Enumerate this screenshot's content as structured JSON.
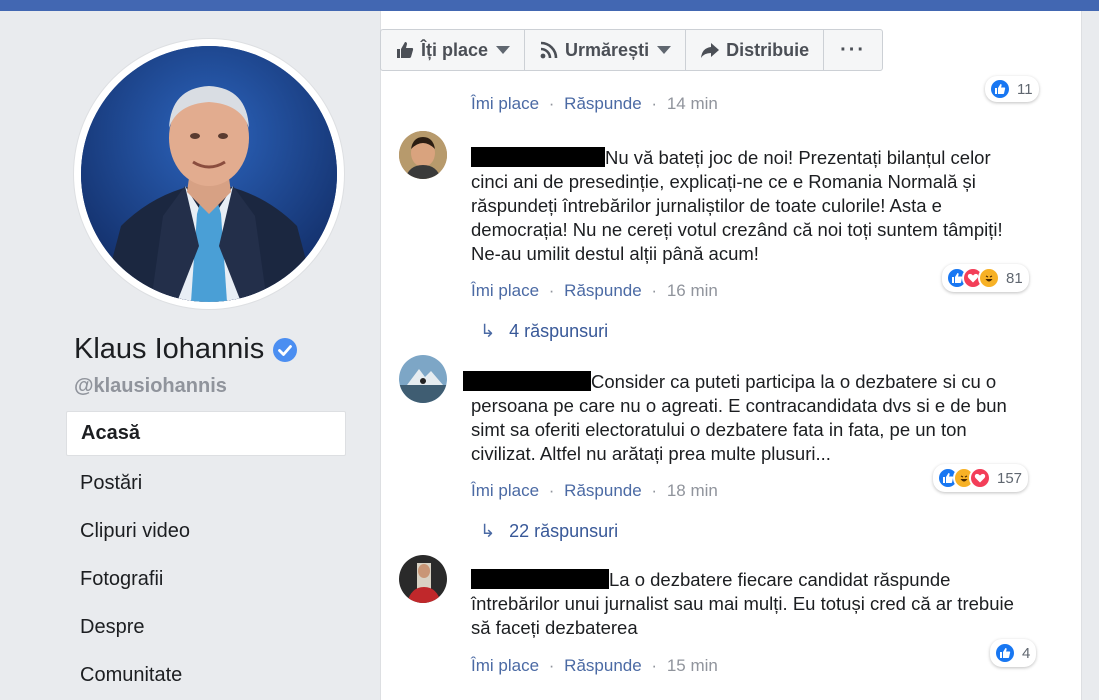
{
  "profile": {
    "name": "Klaus Iohannis",
    "handle": "@klausiohannis"
  },
  "nav": [
    {
      "label": "Acasă",
      "active": true
    },
    {
      "label": "Postări"
    },
    {
      "label": "Clipuri video"
    },
    {
      "label": "Fotografii"
    },
    {
      "label": "Despre"
    },
    {
      "label": "Comunitate"
    }
  ],
  "actions": {
    "like": "Îți place",
    "follow": "Urmărești",
    "share": "Distribuie",
    "more": "···"
  },
  "comment_meta": {
    "like": "Îmi place",
    "reply": "Răspunde",
    "dot": "·"
  },
  "top_partial": {
    "time": "14 min",
    "reactions": "11"
  },
  "comments": [
    {
      "text": "Nu vă bateți joc de noi! Prezentați bilanțul celor cinci ani de presedinție, explicați-ne ce e Romania Normală și răspundeți întrebărilor jurnaliștilor de toate culorile! Asta e democrația! Nu ne cereți votul crezând că noi toți suntem tâmpiți! Ne-au umilit destul alții până acum!",
      "time": "16 min",
      "reaction_count": "81",
      "reactions": [
        "like",
        "love",
        "haha"
      ],
      "replies": "4 răspunsuri"
    },
    {
      "text": "Consider ca puteti participa la o dezbatere si cu o persoana pe care nu o agreati. E contracandidata dvs si e de bun simt sa oferiti electoratului o dezbatere fata in fata, pe un ton civilizat. Altfel nu arătați prea multe plusuri...",
      "time": "18 min",
      "reaction_count": "157",
      "reactions": [
        "like",
        "haha",
        "love"
      ],
      "replies": "22 răspunsuri"
    },
    {
      "text": "La o dezbatere fiecare candidat răspunde întrebărilor unui jurnalist sau mai mulți. Eu totuși cred că ar trebuie să faceți dezbaterea",
      "time": "15 min",
      "reaction_count": "4",
      "reactions": [
        "like"
      ]
    }
  ],
  "colors": {
    "brand": "#4267b2",
    "link": "#385898",
    "like": "#1877f2",
    "love": "#f33e58",
    "haha": "#f7b125"
  }
}
